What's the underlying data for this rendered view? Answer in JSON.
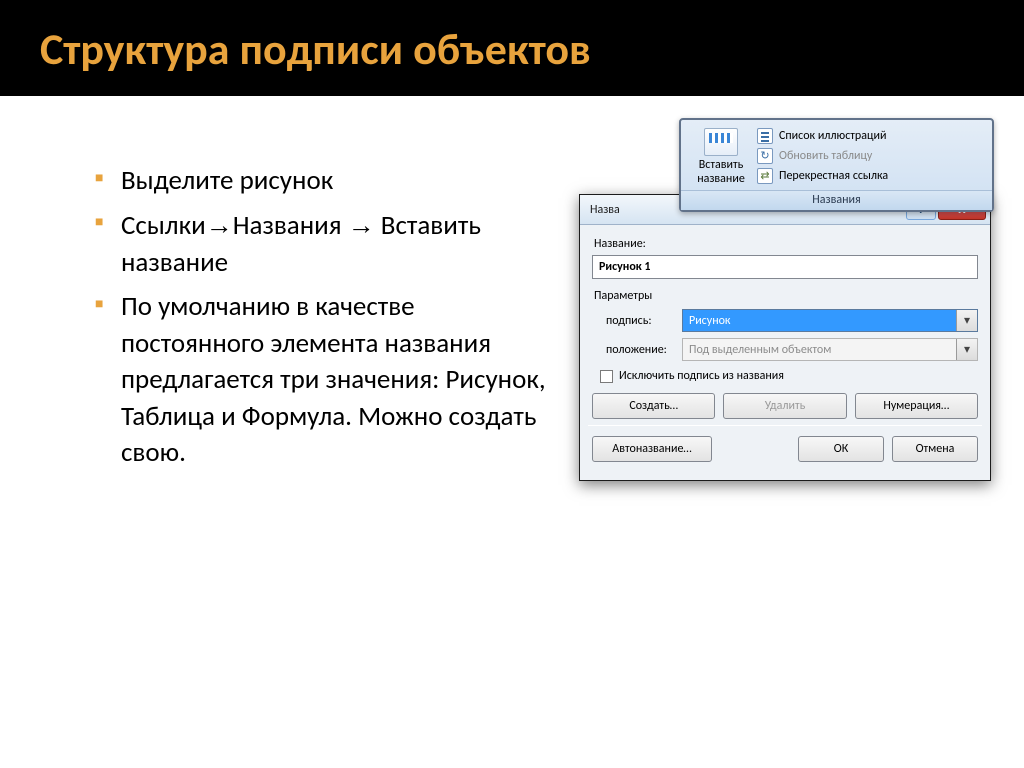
{
  "header": {
    "title": "Структура подписи объектов"
  },
  "bullets": {
    "b1": "Выделите рисунок",
    "b2_pre": "Ссылки",
    "b2_mid": "Названия ",
    "b2_post": "Вставить название",
    "b3": "По умолчанию в качестве постоянного элемента названия предлагается три значения: Рисунок, Таблица и Формула. Можно создать свою."
  },
  "ribbon": {
    "insert_caption": "Вставить название",
    "list": "Список иллюстраций",
    "update": "Обновить таблицу",
    "crossref": "Перекрестная ссылка",
    "group_label": "Названия"
  },
  "dialog": {
    "title": "Назва",
    "help": "?",
    "close": "X",
    "name_label": "Название:",
    "name_value": "Рисунок 1",
    "params_header": "Параметры",
    "caption_lbl": "подпись:",
    "caption_val": "Рисунок",
    "position_lbl": "положение:",
    "position_val": "Под выделенным объектом",
    "exclude": "Исключить подпись из названия",
    "btn_new": "Создать…",
    "btn_delete": "Удалить",
    "btn_numbering": "Нумерация…",
    "btn_autoname": "Автоназвание…",
    "btn_ok": "ОК",
    "btn_cancel": "Отмена"
  }
}
